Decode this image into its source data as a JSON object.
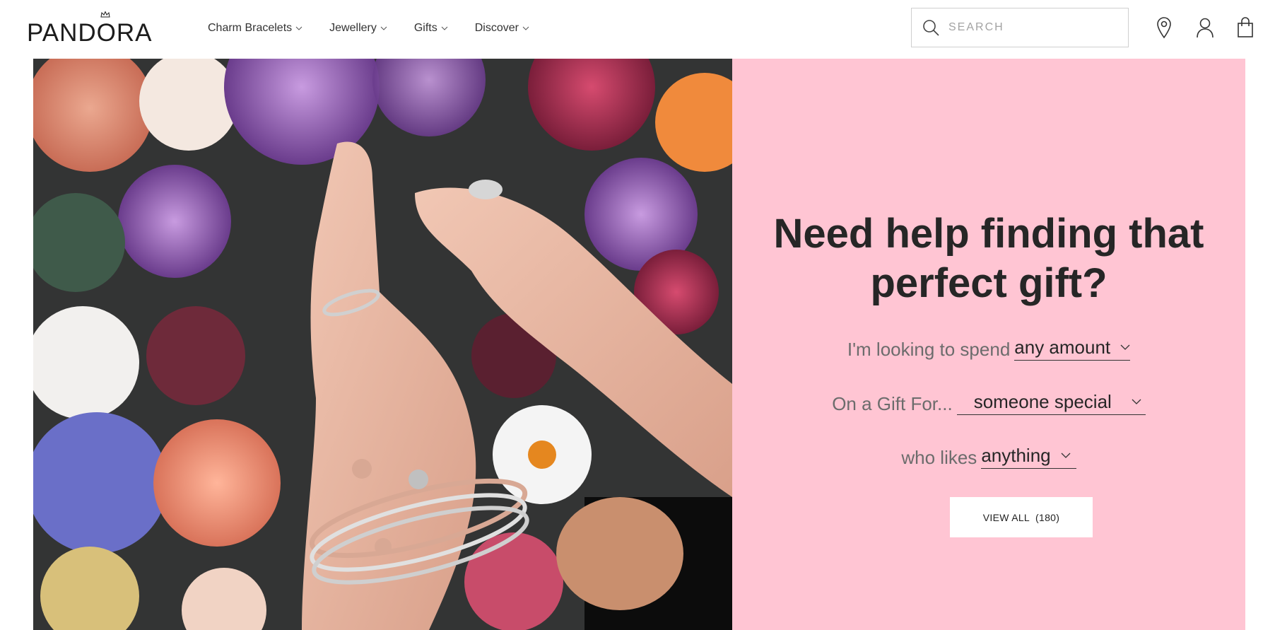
{
  "brand": {
    "logo_text": "PANDORA"
  },
  "nav": {
    "items": [
      {
        "label": "Charm Bracelets"
      },
      {
        "label": "Jewellery"
      },
      {
        "label": "Gifts"
      },
      {
        "label": "Discover"
      }
    ]
  },
  "search": {
    "placeholder": "SEARCH",
    "value": ""
  },
  "header_icons": [
    "store-locator-pin-icon",
    "account-user-icon",
    "shopping-bag-icon"
  ],
  "hero": {
    "headline_line1": "Need help finding that",
    "headline_line2": "perfect gift?",
    "spend_label": "I'm looking to spend",
    "spend_value": "any amount",
    "gift_for_label": "On a Gift For...",
    "gift_for_value": "someone special",
    "likes_label": "who likes",
    "likes_value": "anything",
    "view_all_label": "VIEW ALL",
    "view_all_count": "(180)"
  },
  "colors": {
    "panel_bg": "#ffc5d3",
    "text_dark": "#262626",
    "text_muted": "#6c6c6c"
  }
}
